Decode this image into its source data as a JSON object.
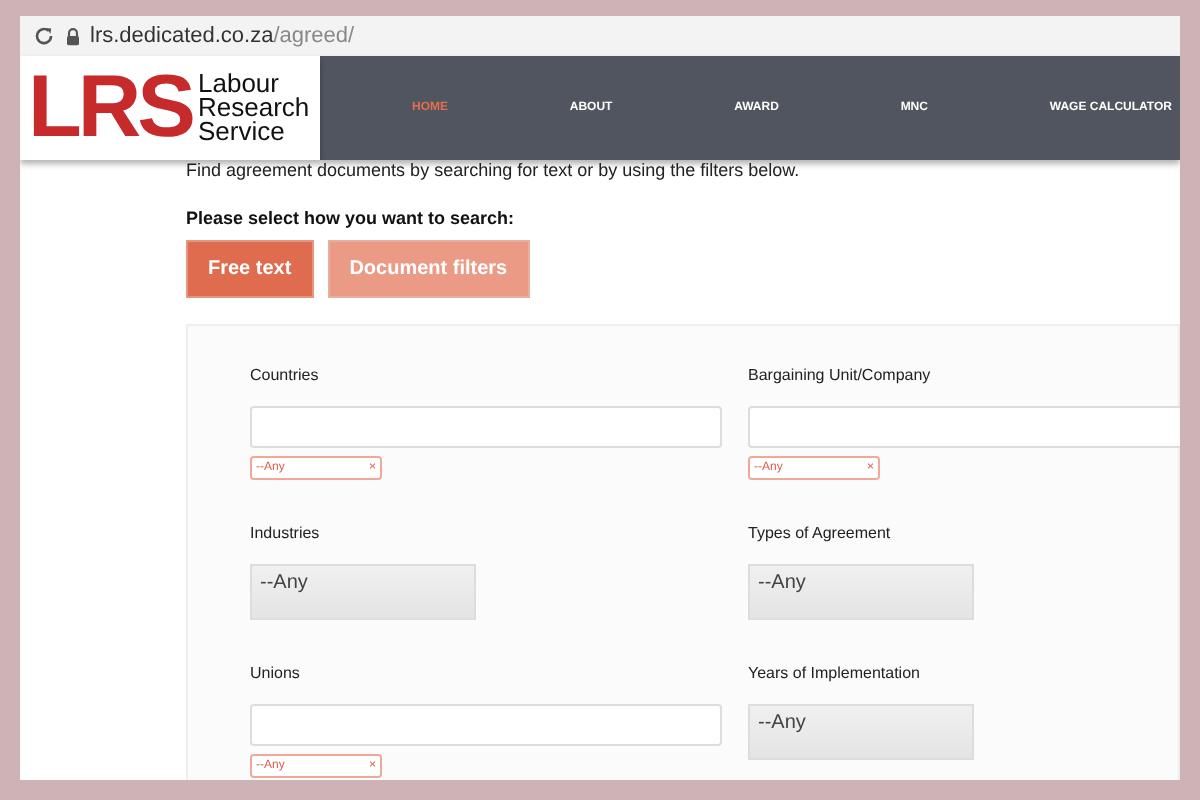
{
  "browser": {
    "url_host": "lrs.dedicated.co.za",
    "url_path": "/agreed/"
  },
  "logo": {
    "mark": "LRS",
    "lines": [
      "Labour",
      "Research",
      "Service"
    ]
  },
  "nav": [
    {
      "label": "HOME",
      "selected": true
    },
    {
      "label": "ABOUT",
      "selected": false
    },
    {
      "label": "AWARD",
      "selected": false
    },
    {
      "label": "MNC",
      "selected": false
    },
    {
      "label": "WAGE CALCULATOR",
      "selected": false
    }
  ],
  "intro": "Find agreement documents by searching for text or by using the filters below.",
  "prompt": "Please select how you want to search:",
  "search_modes": [
    {
      "label": "Free text",
      "selected": true
    },
    {
      "label": "Document filters",
      "selected": false
    }
  ],
  "filters": [
    {
      "kind": "multi",
      "label": "Countries",
      "tag": "--Any",
      "remove": "×"
    },
    {
      "kind": "multi",
      "label": "Bargaining Unit/Company",
      "tag": "--Any",
      "remove": "×"
    },
    {
      "kind": "select",
      "label": "Industries",
      "value": "--Any"
    },
    {
      "kind": "select",
      "label": "Types of Agreement",
      "value": "--Any"
    },
    {
      "kind": "multi",
      "label": "Unions",
      "tag": "--Any",
      "remove": "×"
    },
    {
      "kind": "select",
      "label": "Years of Implementation",
      "value": "--Any"
    }
  ]
}
